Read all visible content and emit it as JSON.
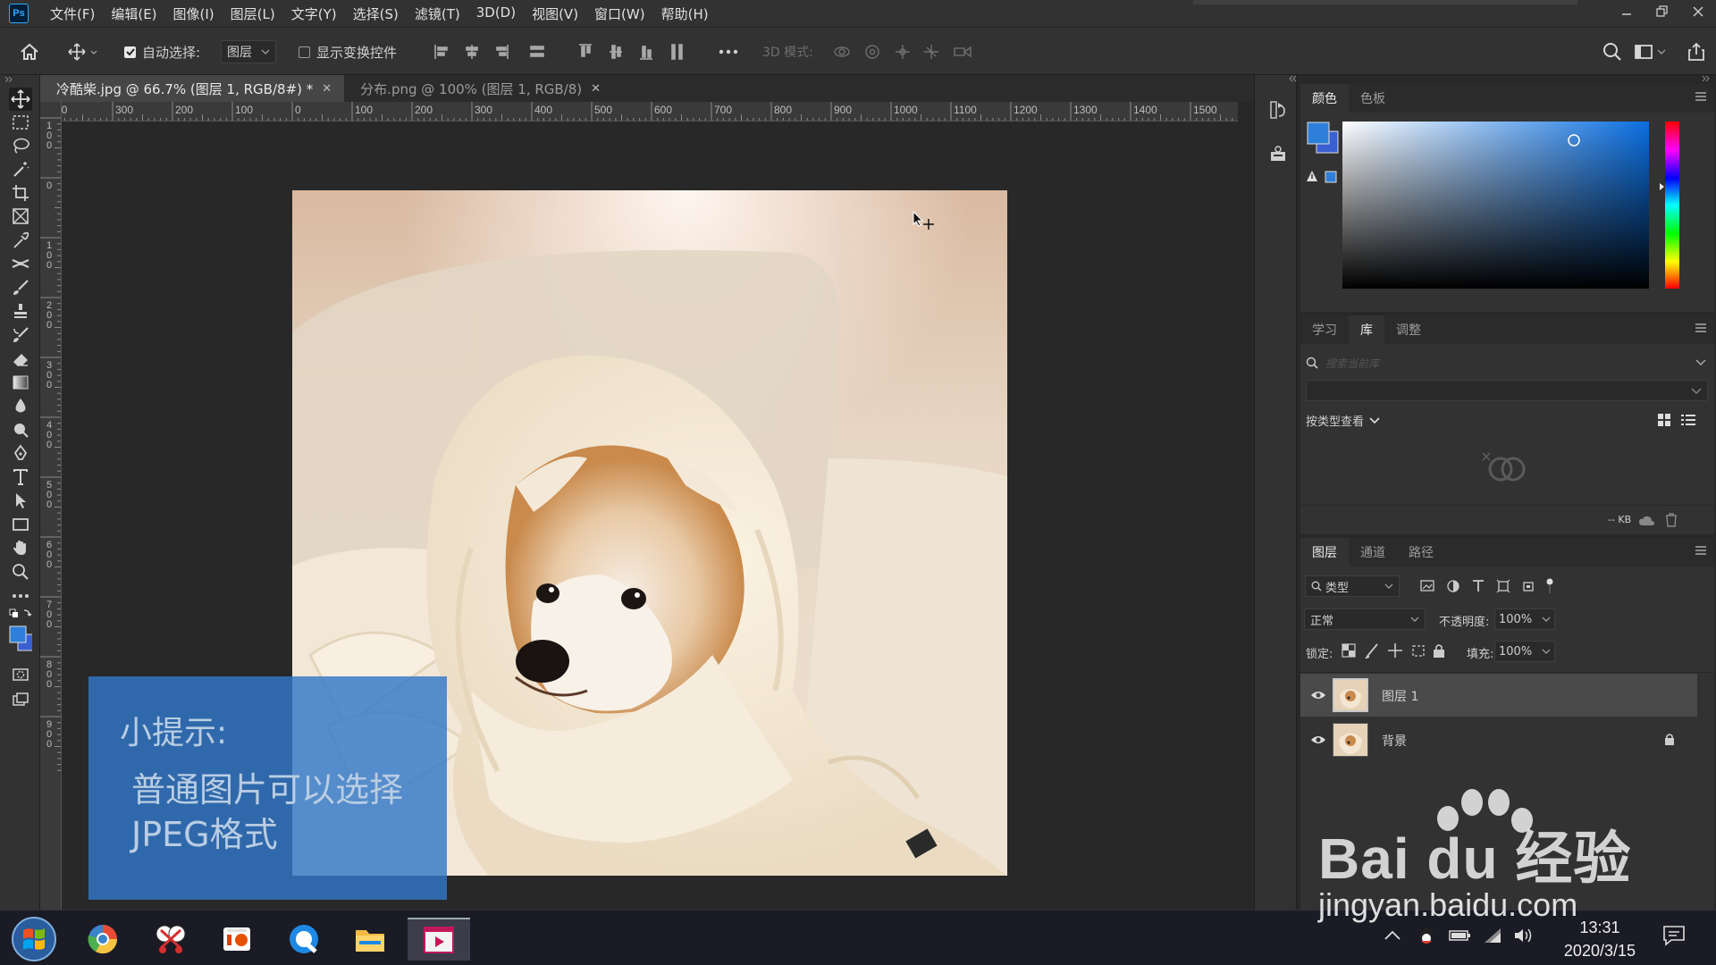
{
  "app": {
    "logo_text": "Ps",
    "menu": [
      "文件(F)",
      "编辑(E)",
      "图像(I)",
      "图层(L)",
      "文字(Y)",
      "选择(S)",
      "滤镜(T)",
      "3D(D)",
      "视图(V)",
      "窗口(W)",
      "帮助(H)"
    ]
  },
  "options_bar": {
    "auto_select_label": "自动选择:",
    "auto_select_checked": true,
    "auto_select_target": "图层",
    "show_transform_label": "显示变换控件",
    "show_transform_checked": false,
    "mode_3d_label": "3D 模式:"
  },
  "tabs": [
    {
      "label": "冷酷柴.jpg @ 66.7% (图层 1, RGB/8#) *",
      "active": true
    },
    {
      "label": "分布.png @ 100% (图层 1, RGB/8)",
      "active": false
    }
  ],
  "ruler": {
    "h_labels": [
      "30",
      "300",
      "200",
      "100",
      "0",
      "100",
      "200",
      "300",
      "400",
      "500",
      "600",
      "700",
      "800",
      "900",
      "1000",
      "1100",
      "1200",
      "1300",
      "1400",
      "1500"
    ],
    "v_labels": [
      "1\n0\n0",
      "0",
      "1\n0\n0",
      "2\n0\n0",
      "3\n0\n0",
      "4\n0\n0",
      "5\n0\n0",
      "6\n0\n0",
      "7\n0\n0",
      "8\n0\n0",
      "9\n0\n0"
    ]
  },
  "tip": {
    "title": "小提示:",
    "body": "普通图片可以选择JPEG格式"
  },
  "color_panel": {
    "tabs": [
      "颜色",
      "色板"
    ],
    "foreground": "#2e7fd9",
    "background": "#3a5fd1",
    "hue_color": "#0b6fe0"
  },
  "library_panel": {
    "tabs": [
      "学习",
      "库",
      "调整"
    ],
    "active_tab": "库",
    "search_placeholder": "搜索当前库",
    "view_by_label": "按类型查看",
    "size_label": "-- KB"
  },
  "layers_panel": {
    "tabs": [
      "图层",
      "通道",
      "路径"
    ],
    "filter_label": "类型",
    "blend_mode": "正常",
    "opacity_label": "不透明度:",
    "opacity_value": "100%",
    "lock_label": "锁定:",
    "fill_label": "填充:",
    "fill_value": "100%",
    "layers": [
      {
        "name": "图层 1",
        "selected": true,
        "locked": false
      },
      {
        "name": "背景",
        "selected": false,
        "locked": true
      }
    ]
  },
  "taskbar": {
    "time": "13:31",
    "date": "2020/3/15"
  },
  "watermark": {
    "brand": "Bai du 经验",
    "url": "jingyan.baidu.com"
  }
}
